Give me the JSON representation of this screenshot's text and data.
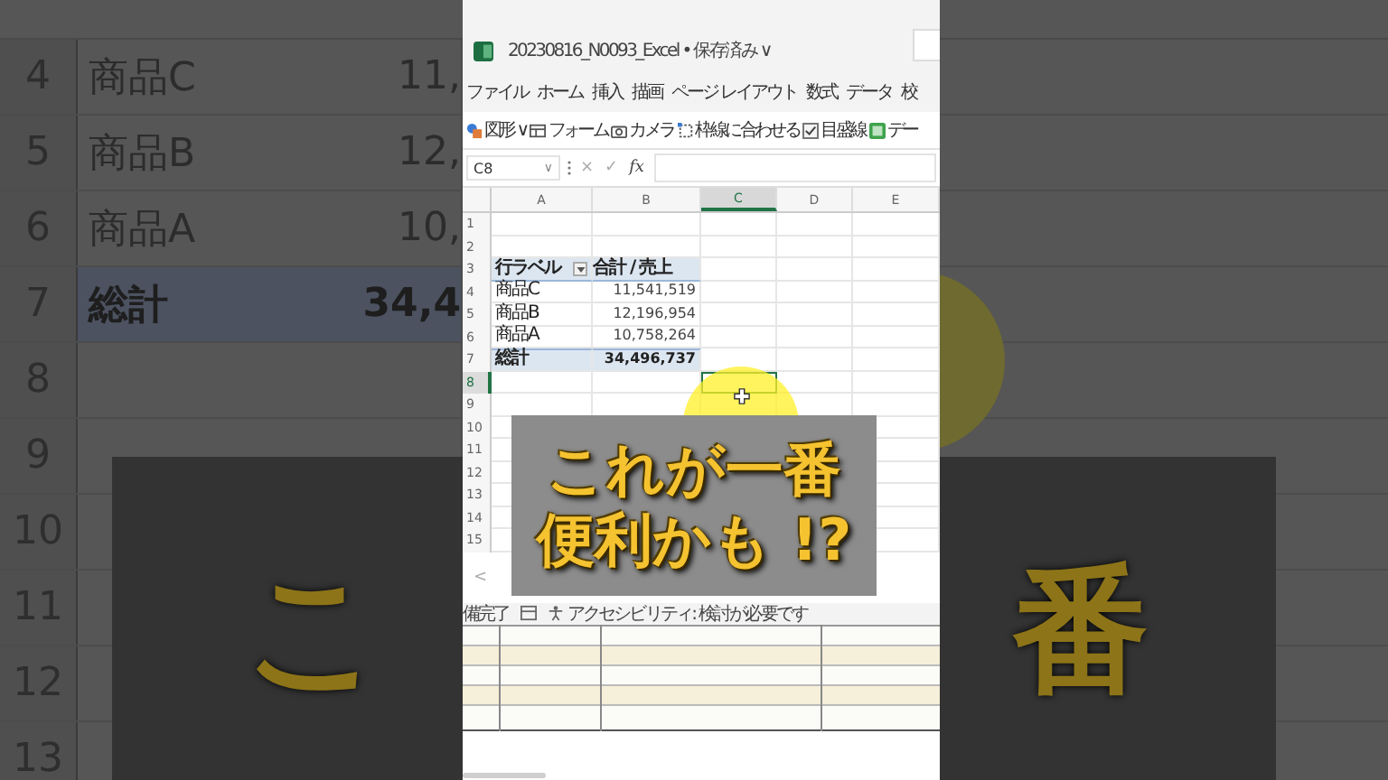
{
  "background": {
    "row_numbers": [
      "4",
      "5",
      "6",
      "7",
      "8",
      "9",
      "10",
      "11",
      "12",
      "13"
    ],
    "rows": [
      {
        "label": "商品C",
        "value": "11,",
        "kind": "item"
      },
      {
        "label": "商品B",
        "value": "12,",
        "kind": "item"
      },
      {
        "label": "商品A",
        "value": "10,",
        "kind": "item"
      },
      {
        "label": "総計",
        "value": "34,4",
        "kind": "total"
      }
    ],
    "caption_left": "こ",
    "caption_right": "番"
  },
  "window": {
    "title": "20230816_N0093_Excel • 保存済み ∨"
  },
  "menu": [
    "ファイル",
    "ホーム",
    "挿入",
    "描画",
    "ページ レイアウト",
    "数式",
    "データ",
    "校"
  ],
  "toolbar": [
    {
      "kind": "shapes",
      "label": "図形 ∨"
    },
    {
      "kind": "form",
      "label": "フォーム"
    },
    {
      "kind": "camera",
      "label": "カメラ"
    },
    {
      "kind": "snap",
      "label": "枠線に合わせる"
    },
    {
      "kind": "checkbox",
      "label": "目盛線",
      "checked": true
    },
    {
      "kind": "data",
      "label": "デー"
    }
  ],
  "formula_bar": {
    "name_box": "C8",
    "caret": "∨",
    "cancel": "×",
    "enter": "✓",
    "function": "fx"
  },
  "sheet": {
    "columns": [
      {
        "label": "A",
        "selected": false
      },
      {
        "label": "B",
        "selected": false
      },
      {
        "label": "C",
        "selected": true
      },
      {
        "label": "D",
        "selected": false
      },
      {
        "label": "E",
        "selected": false
      }
    ],
    "rows": [
      {
        "number": "1",
        "kind": "blank",
        "selected": false
      },
      {
        "number": "2",
        "kind": "blank",
        "selected": false
      },
      {
        "number": "3",
        "kind": "header",
        "selected": false,
        "cells": [
          "行ラベル",
          "合計 / 売上"
        ]
      },
      {
        "number": "4",
        "kind": "item",
        "selected": false,
        "cells": [
          "商品C",
          "11,541,519"
        ]
      },
      {
        "number": "5",
        "kind": "item",
        "selected": false,
        "cells": [
          "商品B",
          "12,196,954"
        ]
      },
      {
        "number": "6",
        "kind": "item",
        "selected": false,
        "cells": [
          "商品A",
          "10,758,264"
        ]
      },
      {
        "number": "7",
        "kind": "total",
        "selected": false,
        "cells": [
          "総計",
          "34,496,737"
        ]
      },
      {
        "number": "8",
        "kind": "blank",
        "selected": true
      },
      {
        "number": "9",
        "kind": "blank",
        "selected": false
      },
      {
        "number": "10",
        "kind": "blank",
        "selected": false
      },
      {
        "number": "11",
        "kind": "blank",
        "selected": false
      },
      {
        "number": "12",
        "kind": "blank",
        "selected": false
      },
      {
        "number": "13",
        "kind": "blank",
        "selected": false
      },
      {
        "number": "14",
        "kind": "blank",
        "selected": false
      },
      {
        "number": "15",
        "kind": "blank",
        "selected": false
      }
    ]
  },
  "caption": {
    "lines": [
      "これが一番",
      "便利かも !?"
    ]
  },
  "sheet_nav": "<",
  "status_bar": {
    "ready": "備完了",
    "accessibility": "アクセシビリティ: 検討が必要です"
  }
}
